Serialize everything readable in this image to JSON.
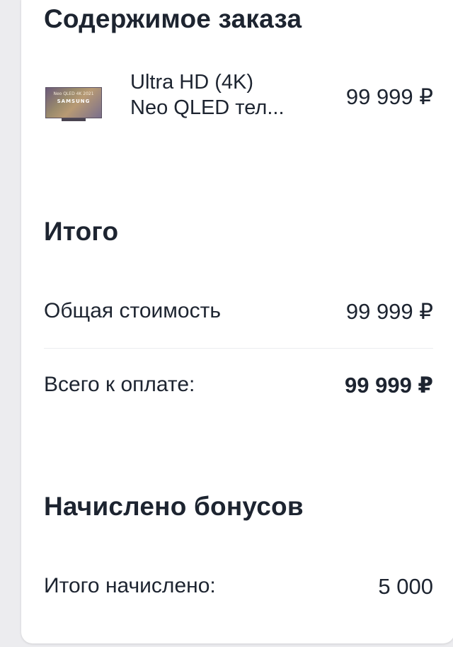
{
  "order": {
    "title": "Содержимое заказа",
    "product": {
      "thumb_line": "Neo QLED 4K 2021",
      "thumb_brand": "SAMSUNG",
      "name_line1": "Ultra HD (4K)",
      "name_line2": "Neo QLED тел...",
      "price": "99 999 ₽"
    }
  },
  "total": {
    "title": "Итого",
    "total_cost_label": "Общая стоимость",
    "total_cost_value": "99 999 ₽",
    "to_pay_label": "Всего к оплате:",
    "to_pay_value": "99 999 ₽"
  },
  "bonus": {
    "title": "Начислено бонусов",
    "accrued_label": "Итого начислено:",
    "accrued_value": "5 000"
  },
  "colors": {
    "text": "#1d2430",
    "card": "#ffffff",
    "background": "#ececef",
    "divider": "#ebedf0"
  }
}
